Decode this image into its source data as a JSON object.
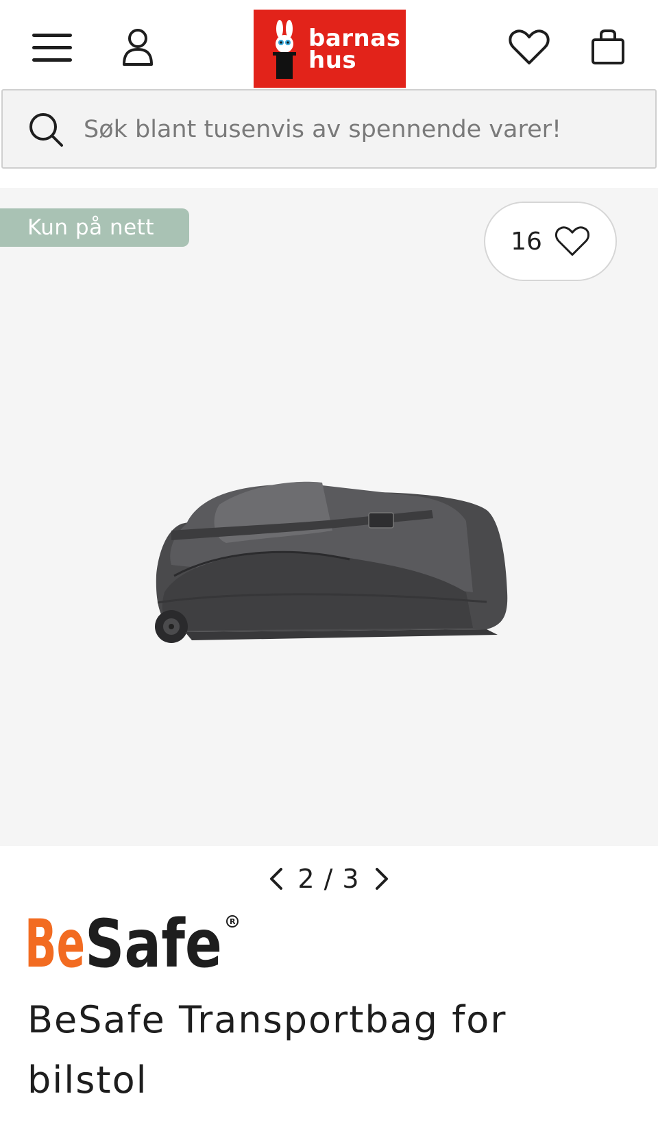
{
  "header": {
    "logo_text_line1": "barnas",
    "logo_text_line2": "hus",
    "brand_color": "#e2231a",
    "icons": [
      "menu-icon",
      "user-icon",
      "heart-icon",
      "shopping-bag-icon"
    ]
  },
  "search": {
    "placeholder": "Søk blant tusenvis av spennende varer!"
  },
  "gallery": {
    "badge": "Kun på nett",
    "badge_color": "#a9c2b4",
    "like_count": "16",
    "pager": {
      "current": "2",
      "separator": "/",
      "total": "3"
    }
  },
  "product": {
    "brand": "BeSafe",
    "brand_colors": {
      "be": "#f26b21",
      "safe": "#1e1e1e"
    },
    "title": "BeSafe Transportbag for bilstol"
  }
}
